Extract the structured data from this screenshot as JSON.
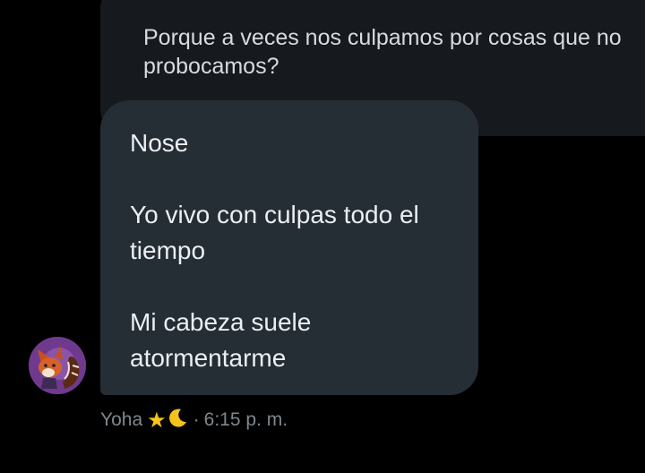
{
  "quoted_message": {
    "lines": [
      "Porque a veces nos culpamos por cosas que no",
      "probocamos?"
    ]
  },
  "message": {
    "paragraphs": [
      "Nose",
      "Yo vivo con culpas todo el tiempo",
      "Mi cabeza suele atormentarme"
    ],
    "sender": "Yoha",
    "separator": "·",
    "time": "6:15 p. m.",
    "name_emojis": [
      "star-icon",
      "crescent-moon-icon"
    ]
  },
  "colors": {
    "background": "#000000",
    "quoted_bubble": "#16191d",
    "message_bubble": "#252d35",
    "avatar_bg": "#6f3a8e",
    "star": "#f7c51b",
    "moon": "#f4c21a"
  }
}
